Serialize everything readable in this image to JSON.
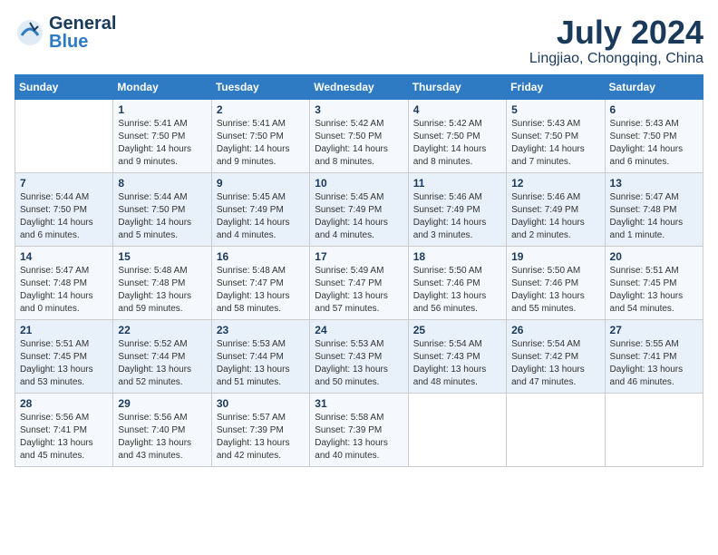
{
  "header": {
    "logo_line1": "General",
    "logo_line2": "Blue",
    "month": "July 2024",
    "location": "Lingjiao, Chongqing, China"
  },
  "weekdays": [
    "Sunday",
    "Monday",
    "Tuesday",
    "Wednesday",
    "Thursday",
    "Friday",
    "Saturday"
  ],
  "weeks": [
    [
      {
        "day": "",
        "info": ""
      },
      {
        "day": "1",
        "info": "Sunrise: 5:41 AM\nSunset: 7:50 PM\nDaylight: 14 hours\nand 9 minutes."
      },
      {
        "day": "2",
        "info": "Sunrise: 5:41 AM\nSunset: 7:50 PM\nDaylight: 14 hours\nand 9 minutes."
      },
      {
        "day": "3",
        "info": "Sunrise: 5:42 AM\nSunset: 7:50 PM\nDaylight: 14 hours\nand 8 minutes."
      },
      {
        "day": "4",
        "info": "Sunrise: 5:42 AM\nSunset: 7:50 PM\nDaylight: 14 hours\nand 8 minutes."
      },
      {
        "day": "5",
        "info": "Sunrise: 5:43 AM\nSunset: 7:50 PM\nDaylight: 14 hours\nand 7 minutes."
      },
      {
        "day": "6",
        "info": "Sunrise: 5:43 AM\nSunset: 7:50 PM\nDaylight: 14 hours\nand 6 minutes."
      }
    ],
    [
      {
        "day": "7",
        "info": "Sunrise: 5:44 AM\nSunset: 7:50 PM\nDaylight: 14 hours\nand 6 minutes."
      },
      {
        "day": "8",
        "info": "Sunrise: 5:44 AM\nSunset: 7:50 PM\nDaylight: 14 hours\nand 5 minutes."
      },
      {
        "day": "9",
        "info": "Sunrise: 5:45 AM\nSunset: 7:49 PM\nDaylight: 14 hours\nand 4 minutes."
      },
      {
        "day": "10",
        "info": "Sunrise: 5:45 AM\nSunset: 7:49 PM\nDaylight: 14 hours\nand 4 minutes."
      },
      {
        "day": "11",
        "info": "Sunrise: 5:46 AM\nSunset: 7:49 PM\nDaylight: 14 hours\nand 3 minutes."
      },
      {
        "day": "12",
        "info": "Sunrise: 5:46 AM\nSunset: 7:49 PM\nDaylight: 14 hours\nand 2 minutes."
      },
      {
        "day": "13",
        "info": "Sunrise: 5:47 AM\nSunset: 7:48 PM\nDaylight: 14 hours\nand 1 minute."
      }
    ],
    [
      {
        "day": "14",
        "info": "Sunrise: 5:47 AM\nSunset: 7:48 PM\nDaylight: 14 hours\nand 0 minutes."
      },
      {
        "day": "15",
        "info": "Sunrise: 5:48 AM\nSunset: 7:48 PM\nDaylight: 13 hours\nand 59 minutes."
      },
      {
        "day": "16",
        "info": "Sunrise: 5:48 AM\nSunset: 7:47 PM\nDaylight: 13 hours\nand 58 minutes."
      },
      {
        "day": "17",
        "info": "Sunrise: 5:49 AM\nSunset: 7:47 PM\nDaylight: 13 hours\nand 57 minutes."
      },
      {
        "day": "18",
        "info": "Sunrise: 5:50 AM\nSunset: 7:46 PM\nDaylight: 13 hours\nand 56 minutes."
      },
      {
        "day": "19",
        "info": "Sunrise: 5:50 AM\nSunset: 7:46 PM\nDaylight: 13 hours\nand 55 minutes."
      },
      {
        "day": "20",
        "info": "Sunrise: 5:51 AM\nSunset: 7:45 PM\nDaylight: 13 hours\nand 54 minutes."
      }
    ],
    [
      {
        "day": "21",
        "info": "Sunrise: 5:51 AM\nSunset: 7:45 PM\nDaylight: 13 hours\nand 53 minutes."
      },
      {
        "day": "22",
        "info": "Sunrise: 5:52 AM\nSunset: 7:44 PM\nDaylight: 13 hours\nand 52 minutes."
      },
      {
        "day": "23",
        "info": "Sunrise: 5:53 AM\nSunset: 7:44 PM\nDaylight: 13 hours\nand 51 minutes."
      },
      {
        "day": "24",
        "info": "Sunrise: 5:53 AM\nSunset: 7:43 PM\nDaylight: 13 hours\nand 50 minutes."
      },
      {
        "day": "25",
        "info": "Sunrise: 5:54 AM\nSunset: 7:43 PM\nDaylight: 13 hours\nand 48 minutes."
      },
      {
        "day": "26",
        "info": "Sunrise: 5:54 AM\nSunset: 7:42 PM\nDaylight: 13 hours\nand 47 minutes."
      },
      {
        "day": "27",
        "info": "Sunrise: 5:55 AM\nSunset: 7:41 PM\nDaylight: 13 hours\nand 46 minutes."
      }
    ],
    [
      {
        "day": "28",
        "info": "Sunrise: 5:56 AM\nSunset: 7:41 PM\nDaylight: 13 hours\nand 45 minutes."
      },
      {
        "day": "29",
        "info": "Sunrise: 5:56 AM\nSunset: 7:40 PM\nDaylight: 13 hours\nand 43 minutes."
      },
      {
        "day": "30",
        "info": "Sunrise: 5:57 AM\nSunset: 7:39 PM\nDaylight: 13 hours\nand 42 minutes."
      },
      {
        "day": "31",
        "info": "Sunrise: 5:58 AM\nSunset: 7:39 PM\nDaylight: 13 hours\nand 40 minutes."
      },
      {
        "day": "",
        "info": ""
      },
      {
        "day": "",
        "info": ""
      },
      {
        "day": "",
        "info": ""
      }
    ]
  ]
}
